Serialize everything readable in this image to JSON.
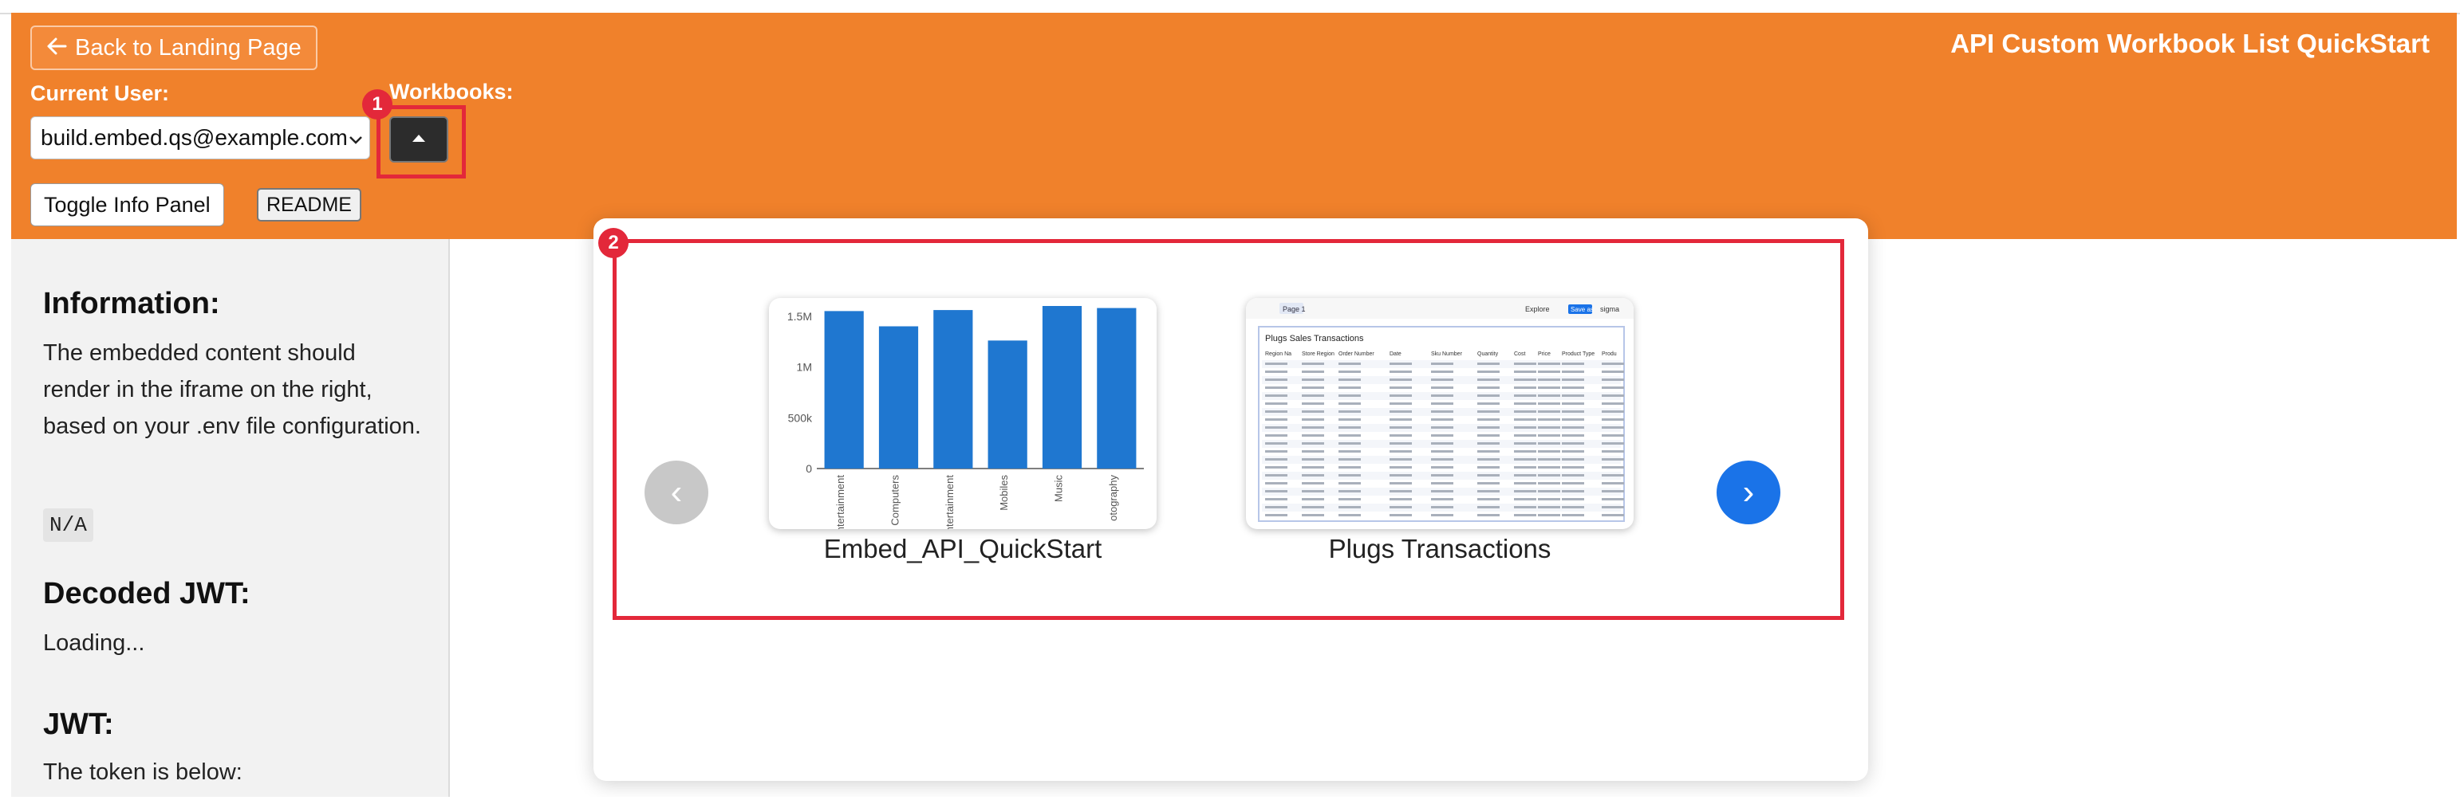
{
  "header": {
    "back_label": "Back to Landing Page",
    "app_title": "API Custom Workbook List QuickStart",
    "current_user_label": "Current User:",
    "workbooks_label": "Workbooks:",
    "user_value": "build.embed.qs@example.com",
    "toggle_label": "Toggle Info Panel",
    "readme_label": "README"
  },
  "markers": [
    "1",
    "2"
  ],
  "sidebar": {
    "info_heading": "Information:",
    "info_text": "The embedded content should render in the iframe on the right, based on your .env file configuration.",
    "na_badge": "N/A",
    "jwt_decoded_heading": "Decoded JWT:",
    "loading": "Loading...",
    "jwt_heading": "JWT:",
    "token_text": "The token is below:"
  },
  "carousel": {
    "prev_glyph": "‹",
    "next_glyph": "›",
    "cards": [
      {
        "name": "Embed_API_QuickStart"
      },
      {
        "name": "Plugs Transactions"
      }
    ]
  },
  "colors": {
    "header_bg": "#f0812b",
    "highlight": "#e3283a",
    "next_arrow": "#1a73e8",
    "prev_arrow": "#c8c8c8",
    "bar": "#1f77d0"
  },
  "chart_data": {
    "type": "bar",
    "categories": [
      "ntertainment",
      "Computers",
      "ntertainment",
      "Mobiles",
      "Music",
      "otography"
    ],
    "values": [
      1.55,
      1.4,
      1.56,
      1.26,
      1.6,
      1.58
    ],
    "yticks": [
      "0",
      "500k",
      "1M",
      "1.5M"
    ],
    "ylim": [
      0,
      1.6
    ]
  },
  "thumb2": {
    "page_tab": "Page 1",
    "explore": "Explore",
    "save": "Save as",
    "brand": "sigma",
    "title": "Plugs Sales Transactions",
    "columns": [
      "Region Na",
      "Store Region",
      "Order Number",
      "Date",
      "Sku Number",
      "Quantity",
      "Cost",
      "Price",
      "Product Type",
      "Produ"
    ]
  }
}
